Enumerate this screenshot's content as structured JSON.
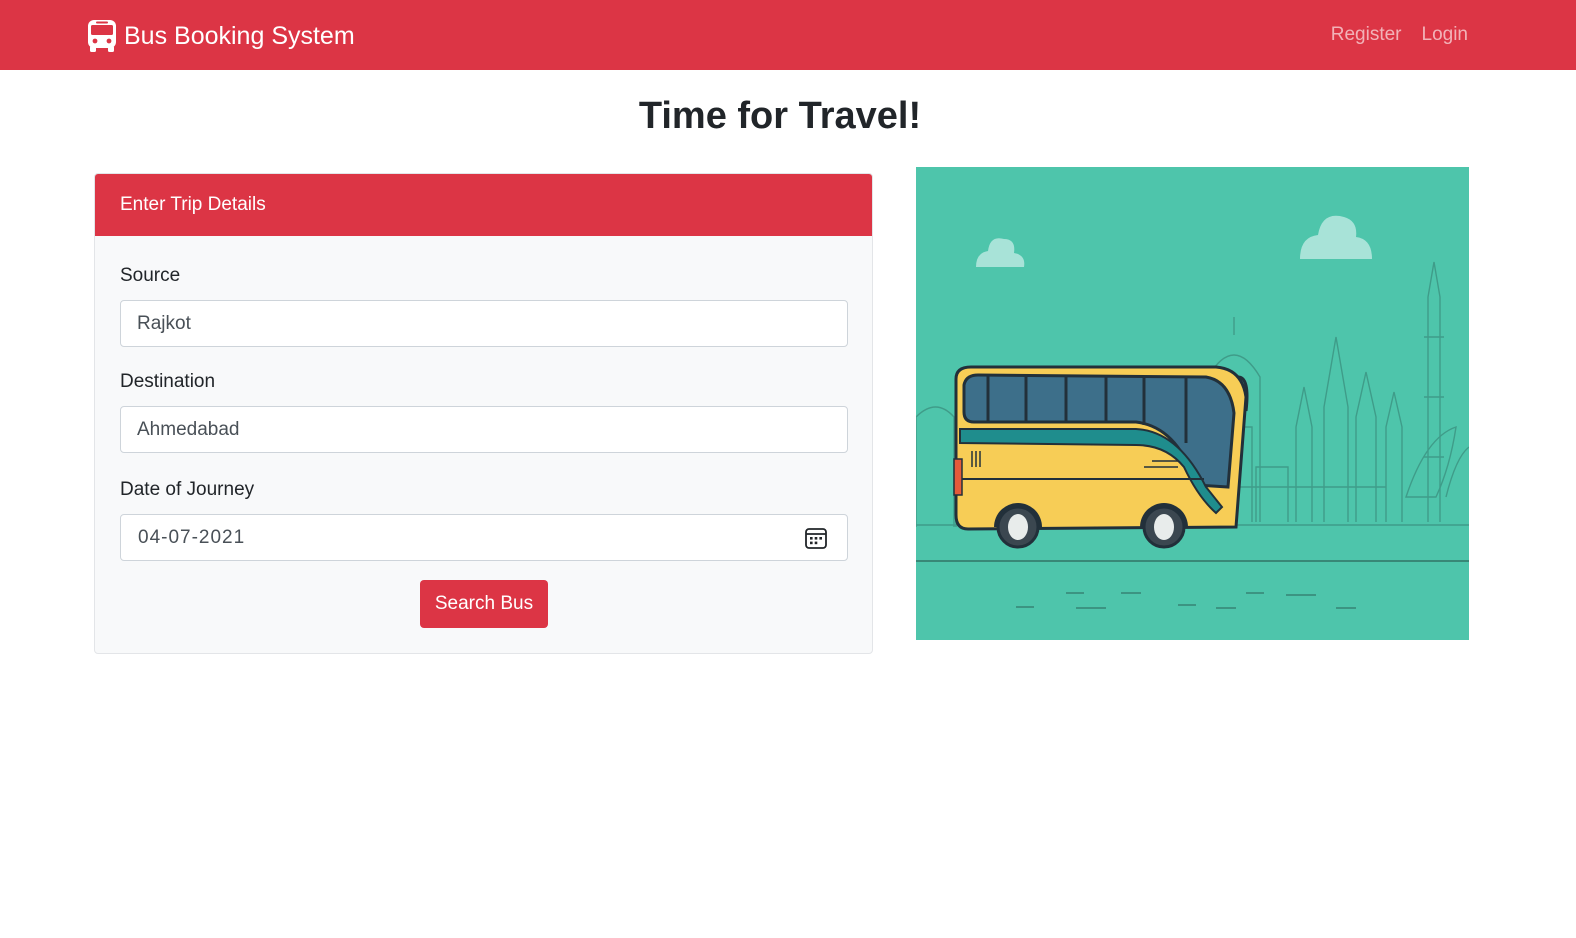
{
  "navbar": {
    "brand_icon": "bus-icon",
    "brand_text": "Bus Booking System",
    "links": [
      "Register",
      "Login"
    ],
    "background_color": "#dc3545"
  },
  "main": {
    "title": "Time for Travel!"
  },
  "trip_form": {
    "header": "Enter Trip Details",
    "source_label": "Source",
    "source_value": "Rajkot",
    "destination_label": "Destination",
    "destination_value": "Ahmedabad",
    "date_label": "Date of Journey",
    "date_value": "04-07-2021",
    "date_icon": "calendar-icon",
    "search_button": "Search Bus"
  },
  "illustration": {
    "subject": "bus-with-city-skyline",
    "background_color": "#4ec5ab",
    "bus_color": "#f7cd56"
  }
}
